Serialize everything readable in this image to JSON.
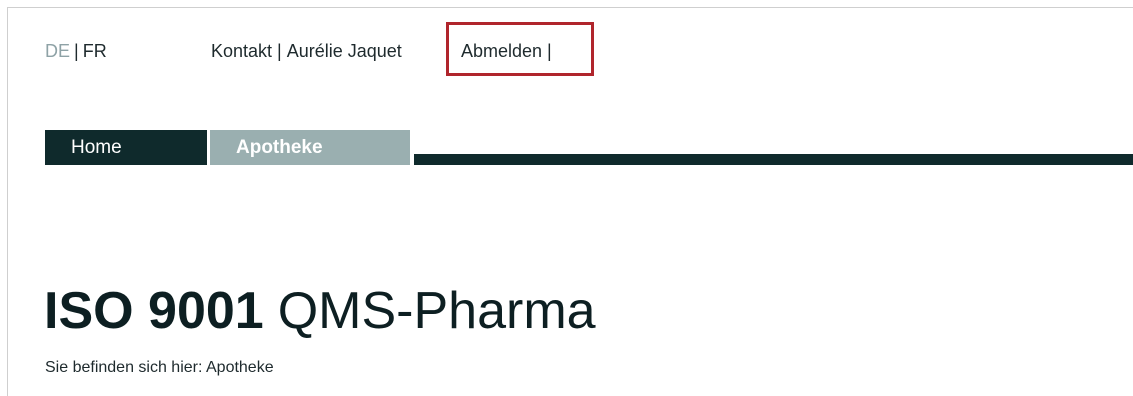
{
  "header": {
    "lang_de": "DE",
    "lang_sep": "|",
    "lang_fr": "FR",
    "contact": "Kontakt",
    "sep": "|",
    "user": "Aurélie Jaquet",
    "logout": "Abmelden |"
  },
  "nav": {
    "home": "Home",
    "apotheke": "Apotheke"
  },
  "page": {
    "title_bold": "ISO 9001",
    "title_rest": "QMS-Pharma",
    "breadcrumb": "Sie befinden sich hier: Apotheke"
  },
  "colors": {
    "highlight_border": "#b0252c",
    "nav_dark": "#0f2a2c",
    "nav_light": "#9aafb0"
  }
}
